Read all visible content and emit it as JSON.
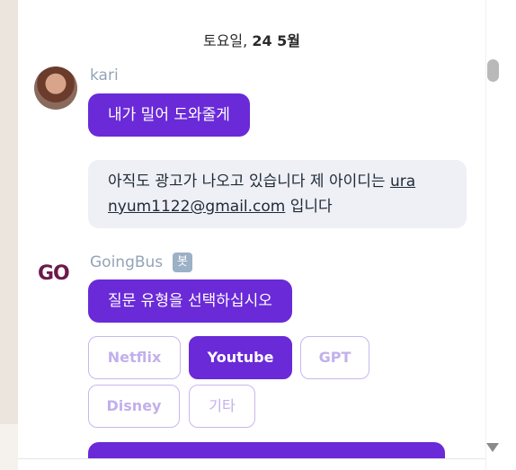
{
  "chat": {
    "date_day": "토요일,",
    "date_rest": "24 5월",
    "messages": [
      {
        "sender": "kari",
        "text": "내가 밀어 도와줄게"
      },
      {
        "text_before": "아직도 광고가 나오고 있습니다 제 아이디는 ",
        "link1": "ura",
        "link2": "nyum1122@gmail.com",
        "text_after": " 입니다"
      },
      {
        "sender": "GoingBus",
        "badge": "봇",
        "logo": "GO",
        "text": "질문 유형을 선택하십시오"
      }
    ],
    "options": [
      {
        "label": "Netflix",
        "selected": false
      },
      {
        "label": "Youtube",
        "selected": true
      },
      {
        "label": "GPT",
        "selected": false
      },
      {
        "label": "Disney",
        "selected": false
      },
      {
        "label": "기타",
        "selected": false
      }
    ]
  },
  "colors": {
    "accent": "#6a2ad8",
    "bubble_gray": "#eef0f5",
    "sender_name": "#93a4b8",
    "option_border": "#c9b7ee"
  }
}
